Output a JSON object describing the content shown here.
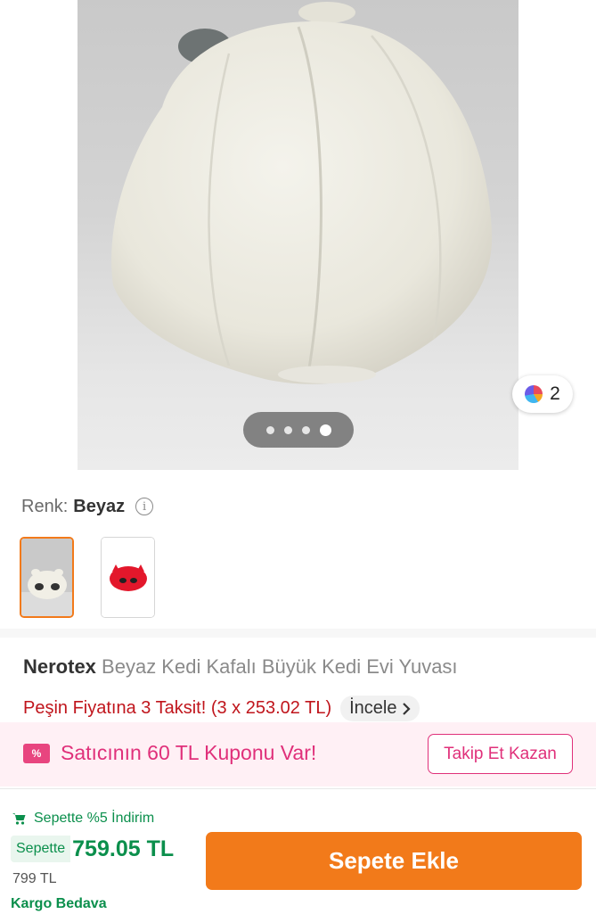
{
  "gallery": {
    "page_count": 4,
    "active_page": 4,
    "variant_count": "2"
  },
  "color_selector": {
    "label": "Renk:",
    "value": "Beyaz",
    "swatches": [
      {
        "name": "Beyaz",
        "selected": true
      },
      {
        "name": "Kırmızı",
        "selected": false
      }
    ]
  },
  "product": {
    "brand": "Nerotex",
    "name": "Beyaz Kedi Kafalı Büyük Kedi Evi Yuvası",
    "installment_text": "Peşin Fiyatına 3 Taksit! (3 x 253.02 TL)",
    "review_label": "İncele"
  },
  "coupon": {
    "icon_text": "%",
    "text": "Satıcının 60 TL Kuponu Var!",
    "button": "Takip Et Kazan"
  },
  "bottom_bar": {
    "discount_text": "Sepette %5 İndirim",
    "price_label": "Sepette",
    "price": "759.05 TL",
    "old_price": "799 TL",
    "shipping": "Kargo Bedava",
    "add_to_cart": "Sepete Ekle"
  },
  "colors": {
    "accent_orange": "#f27a1a",
    "discount_green": "#0b8f4c",
    "coupon_pink": "#e0307a",
    "installment_red": "#c0151c"
  }
}
